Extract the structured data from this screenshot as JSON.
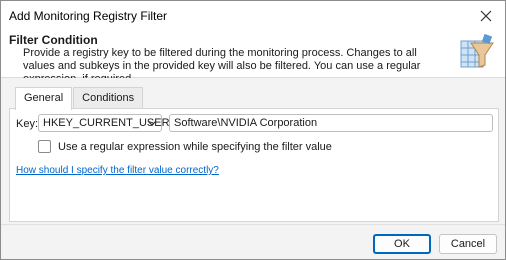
{
  "window": {
    "title": "Add Monitoring Registry Filter"
  },
  "header": {
    "title": "Filter Condition",
    "description": "Provide a registry key to be filtered during the monitoring process. Changes to all values and subkeys in the provided key will also be filtered. You can use a regular expression, if required.",
    "icon": "registry-filter-icon"
  },
  "tabs": [
    {
      "label": "General",
      "active": true
    },
    {
      "label": "Conditions",
      "active": false
    }
  ],
  "general": {
    "key_label": "Key:",
    "hive_value": "HKEY_CURRENT_USER",
    "key_path_value": "Software\\NVIDIA Corporation",
    "regex_checkbox_label": "Use a regular expression while specifying the filter value",
    "regex_checked": false,
    "help_link": "How should I specify the filter value correctly?"
  },
  "buttons": {
    "ok": "OK",
    "cancel": "Cancel"
  },
  "colors": {
    "accent": "#0067c0",
    "link": "#0066cc"
  }
}
